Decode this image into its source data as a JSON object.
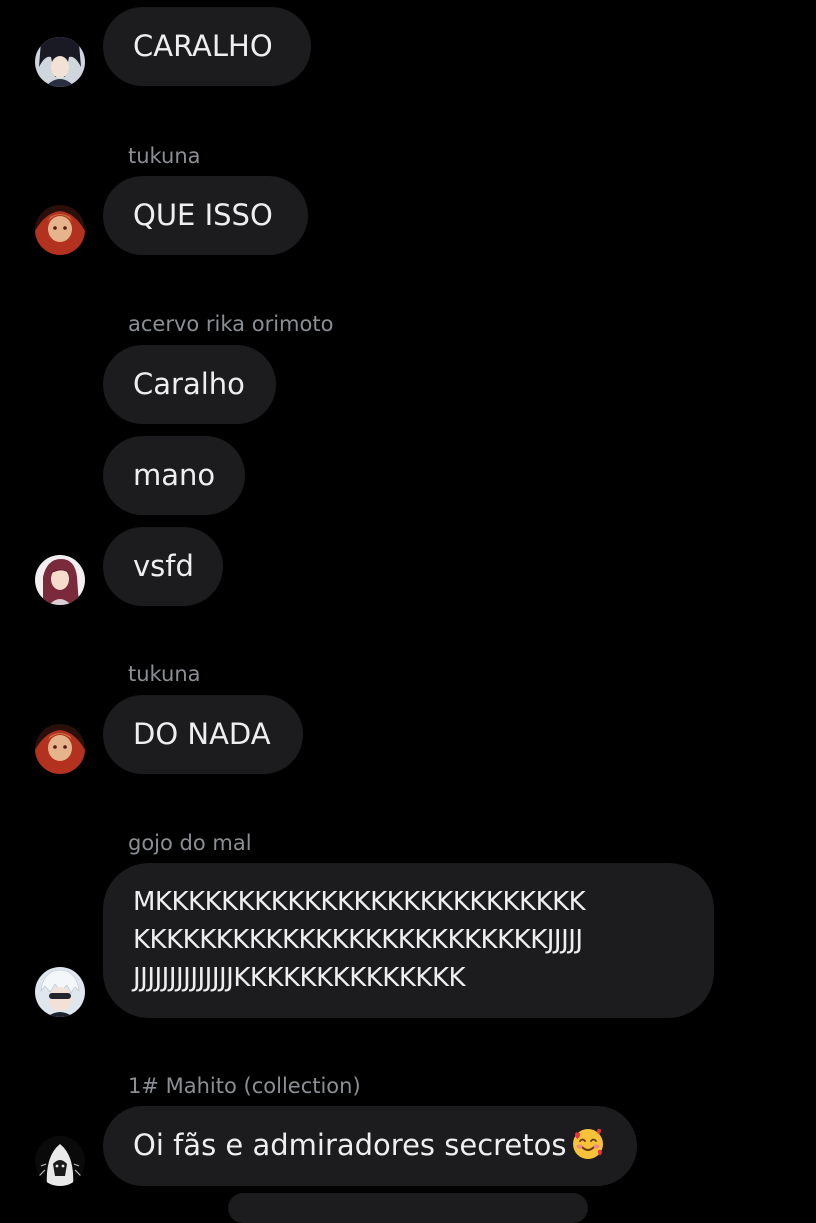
{
  "messages": [
    {
      "sender": "",
      "text": "CARALHO"
    },
    {
      "sender": "tukuna",
      "text": "QUE ISSO"
    },
    {
      "sender": "acervo rika orimoto",
      "texts": [
        "Caralho",
        "mano",
        "vsfd"
      ]
    },
    {
      "sender": "tukuna",
      "text": "DO NADA"
    },
    {
      "sender": "gojo do mal",
      "lines": [
        "MKKKKKKKKKKKKKKKKKKKKKKKKKK",
        "KKKKKKKKKKKKKKKKKKKKKKKKKJJJJJ",
        "JJJJJJJJJJJJJJKKKKKKKKKKKKKK"
      ]
    },
    {
      "sender": "1# Mahito (collection)",
      "text": "Oi fãs e admiradores secretos",
      "emoji": "smiling-face-with-hearts-icon"
    }
  ]
}
